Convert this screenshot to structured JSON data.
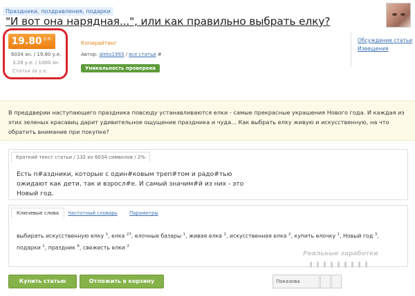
{
  "header": {
    "category": "Праздники, поздравления, подарки",
    "title": "\"И вот она нарядная...\", или как правильно выбрать елку?"
  },
  "price": {
    "value": "19.80",
    "currency": "у.е.",
    "line1": "6034 зн. / 19.80 у.е.",
    "line2": "3.28 у.е. / 1000 зн.",
    "line3": "Статья за у.е."
  },
  "meta": {
    "type": "Копирайтинг",
    "author_label": "Автор:",
    "author_name": "aleks1993",
    "separator": "/",
    "all_articles": "все статьи",
    "all_articles_icon": "#",
    "uniqueness": "Уникальность проверена"
  },
  "side_links": {
    "discussion": "Обсуждение статьи",
    "notifications": "Извещения"
  },
  "description": "В преддверии наступающего праздника повсюду устанавливаются елки - самые прекрасные украшения Нового года. И каждая из этих зеленых красавиц дарит удивительное ощущение праздника и чуда... Как выбрать елку живую и искусственную, на что обратить внимание при покупке?",
  "short_text": {
    "tab_label": "Краткий текст статьи / 132 из 6034 символов / 2%",
    "text": "Есть п#аздники, которые с один#ковым треп#том и радо#тью ожидают как дети, так и взросл#е. И самый значим#й из них - это Новый год."
  },
  "keywords": {
    "tabs": [
      "Ключевые слова",
      "Частотный словарь",
      "Параметры"
    ],
    "items": [
      {
        "word": "выбирать искусственную елку",
        "count": "1"
      },
      {
        "word": "елка",
        "count": "27"
      },
      {
        "word": "елочные базары",
        "count": "1"
      },
      {
        "word": "живая елка",
        "count": "2"
      },
      {
        "word": "искусственная елка",
        "count": "2"
      },
      {
        "word": "купить елочку",
        "count": "1"
      },
      {
        "word": "Новый год",
        "count": "3"
      },
      {
        "word": "подарки",
        "count": "1"
      },
      {
        "word": "праздник",
        "count": "6"
      },
      {
        "word": "свежесть елки",
        "count": "2"
      }
    ]
  },
  "actions": {
    "buy": "Купить статью",
    "cart": "Отложить в корзину",
    "show": "Показова"
  },
  "watermark": "Реальные заработки",
  "colors": {
    "accent_orange": "#ee7f12",
    "highlight_red": "#d9242a",
    "button_green": "#85b34a",
    "badge_green": "#5e9c3b",
    "link_blue": "#3a6fb0",
    "desc_bg": "#fdfbe8"
  }
}
